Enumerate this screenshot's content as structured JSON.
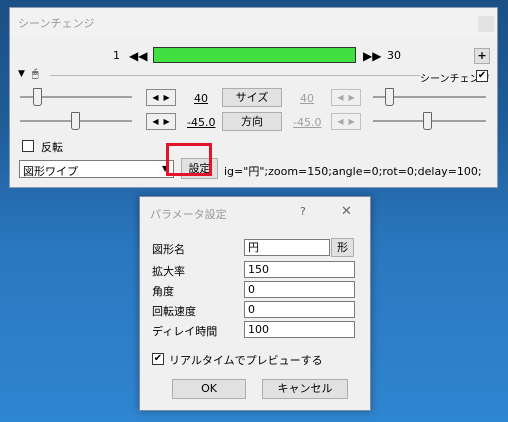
{
  "main": {
    "title": "シーンチェンジ",
    "frame": {
      "start": "1",
      "end": "30",
      "first_icon": "skip-back-icon",
      "last_icon": "skip-forward-icon",
      "add_label": "+"
    },
    "track_toggle": "シーンチェンジ",
    "rows": [
      {
        "left_value": "40",
        "center_label": "サイズ",
        "right_value": "40"
      },
      {
        "left_value": "-45.0",
        "center_label": "方向",
        "right_value": "-45.0"
      }
    ],
    "invert_label": "反転",
    "effect_select": "図形ワイプ",
    "settings_button": "設定",
    "param_text": "ig=\"円\";zoom=150;angle=0;rot=0;delay=100;"
  },
  "dialog": {
    "title": "パラメータ設定",
    "help": "?",
    "close": "✕",
    "fields": [
      {
        "label": "図形名",
        "value": "円"
      },
      {
        "label": "拡大率",
        "value": "150"
      },
      {
        "label": "角度",
        "value": "0"
      },
      {
        "label": "回転速度",
        "value": "0"
      },
      {
        "label": "ディレイ時間",
        "value": "100"
      }
    ],
    "shape_button": "形",
    "preview_label": "リアルタイムでプレビューする",
    "ok": "OK",
    "cancel": "キャンセル"
  },
  "colors": {
    "highlight": "#e3132c",
    "frame_bar": "#3fe03f",
    "desktop": "#2a77bf"
  }
}
